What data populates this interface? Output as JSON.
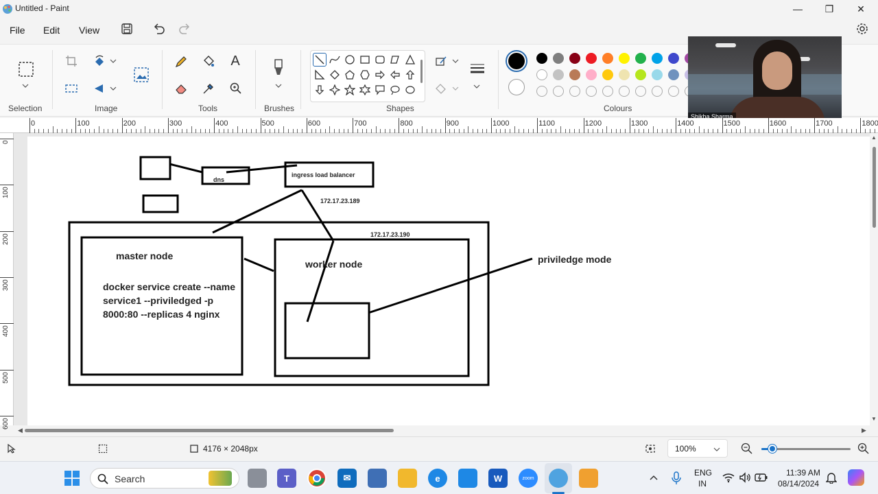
{
  "window": {
    "title": "Untitled - Paint",
    "minimize": "—",
    "maximize": "❐",
    "close": "✕"
  },
  "menu": {
    "file": "File",
    "edit": "Edit",
    "view": "View"
  },
  "ribbon": {
    "groups": {
      "selection": "Selection",
      "image": "Image",
      "tools": "Tools",
      "brushes": "Brushes",
      "shapes": "Shapes",
      "colours": "Colours"
    },
    "tools": {
      "text_glyph": "A"
    },
    "colors_row1": [
      "#000000",
      "#7f7f7f",
      "#880015",
      "#ed1c24",
      "#ff7f27",
      "#fff200",
      "#22b14c",
      "#00a2e8",
      "#3f48cc",
      "#a349a4"
    ],
    "colors_row2": [
      "#ffffff",
      "#c3c3c3",
      "#b97a57",
      "#ffaec9",
      "#ffc90e",
      "#efe4b0",
      "#b5e61d",
      "#99d9ea",
      "#7092be",
      "#c8bfe7"
    ],
    "primary_color": "#000000",
    "secondary_color": "#ffffff"
  },
  "ruler": {
    "h_labels": [
      "0",
      "100",
      "200",
      "300",
      "400",
      "500",
      "600",
      "700",
      "800",
      "900",
      "1000",
      "1100",
      "1200",
      "1300",
      "1400",
      "1500",
      "1600",
      "1700",
      "1800"
    ],
    "v_labels": [
      "0",
      "100",
      "200",
      "300",
      "400",
      "500",
      "600"
    ]
  },
  "drawing": {
    "dns": "dns",
    "ingress": "ingress load balancer",
    "ip1": "172.17.23.189",
    "ip2": "172.17.23.190",
    "master": "master node",
    "worker": "worker node",
    "cmd1": "docker service create --name",
    "cmd2": "service1 --priviledged -p",
    "cmd3": "8000:80 --replicas 4 nginx",
    "priv": "priviledge mode"
  },
  "status": {
    "dimensions": "4176 × 2048px",
    "zoom": "100%"
  },
  "webcam": {
    "name": "Shikha Sharma"
  },
  "taskbar": {
    "search": "Search",
    "lang1": "ENG",
    "lang2": "IN",
    "time": "11:39 AM",
    "date": "08/14/2024",
    "zoom_app": "zoom"
  }
}
